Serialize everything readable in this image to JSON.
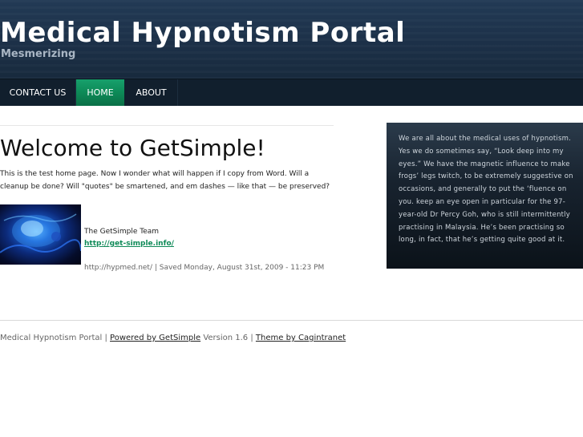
{
  "header": {
    "title": "Medical Hypnotism Portal",
    "tagline": "Mesmerizing"
  },
  "nav": {
    "items": [
      {
        "label": "CONTACT US",
        "active": false
      },
      {
        "label": "HOME",
        "active": true
      },
      {
        "label": "ABOUT",
        "active": false
      }
    ],
    "active_color": "#0f8a58"
  },
  "main": {
    "heading": "Welcome to GetSimple!",
    "intro": "This is the test home page. Now I wonder what will happen if I copy from Word. Will a cleanup be done? Will \"quotes\" be smartened, and em dashes — like that — be preserved?",
    "team": "The GetSimple Team",
    "team_link": "http://get-simple.info/",
    "saved": "http://hypmed.net/ | Saved Monday, August 31st, 2009 - 11:23 PM"
  },
  "sidebar": {
    "text": "We are all about the medical uses of hypnotism. Yes we do sometimes say, “Look deep into my eyes.” We have the magnetic influence to make frogs’ legs twitch, to be extremely suggestive on occasions, and generally to put the ‘fluence on you. keep an eye open in particular for the 97-year-old Dr Percy Goh, who is still intermittently practising in Malaysia. He’s been practising so long, in fact, that he’s getting quite good at it."
  },
  "footer": {
    "site": "Medical Hypnotism Portal",
    "sep1": " | ",
    "powered": "Powered by GetSimple",
    "version": " Version 1.6 | ",
    "theme": "Theme by Cagintranet"
  }
}
